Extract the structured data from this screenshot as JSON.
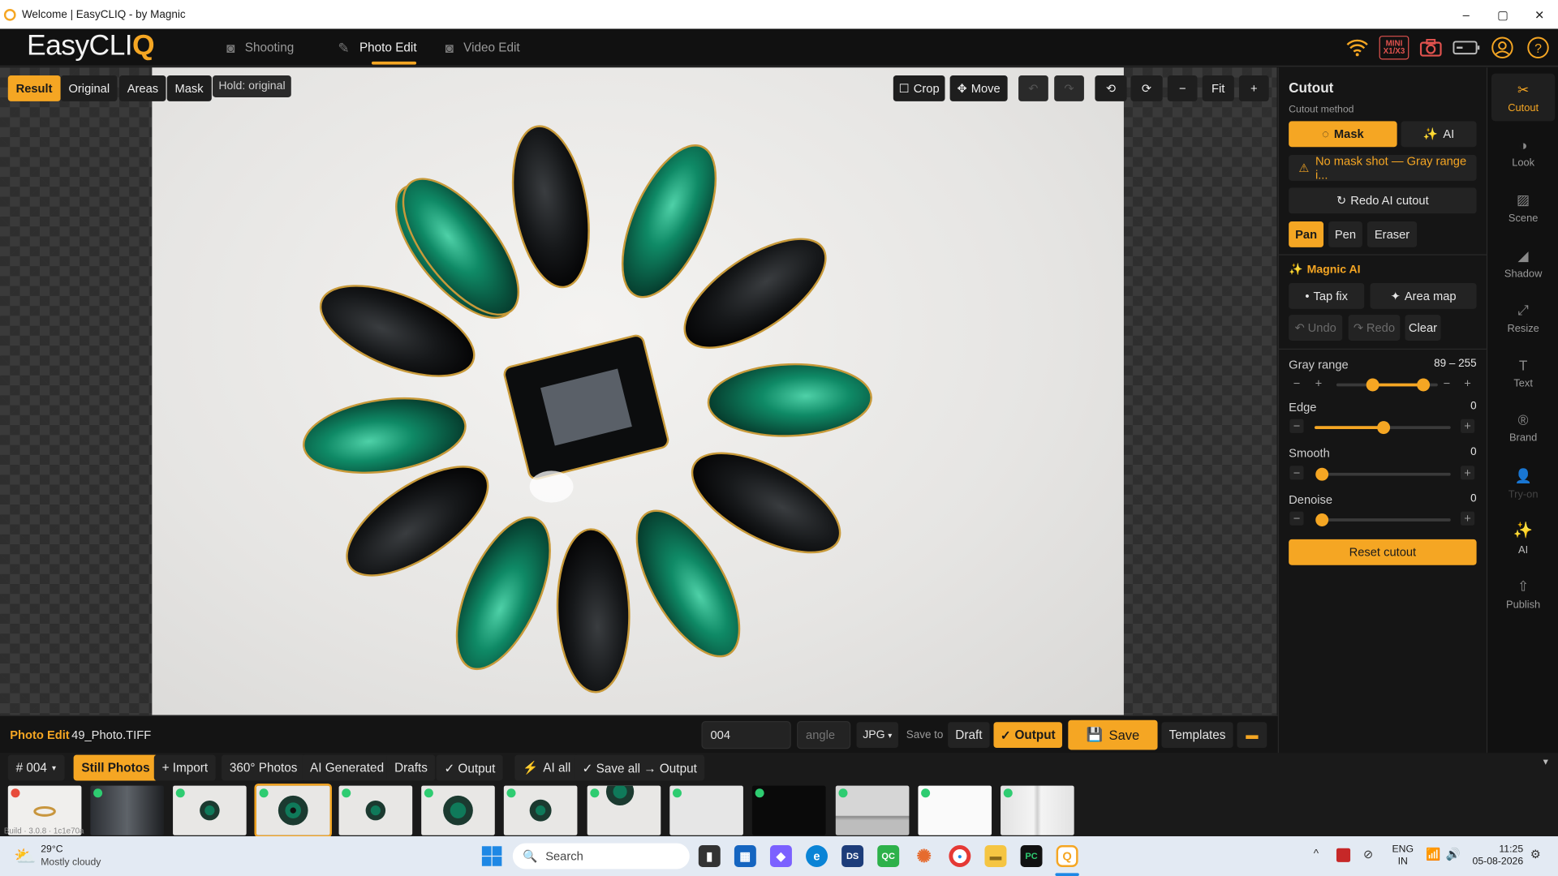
{
  "window": {
    "title": "Welcome | EasyCLIQ - by Magnic",
    "min": "–",
    "max": "▢",
    "close": "✕"
  },
  "app": {
    "logo_main": "EasyCLI",
    "logo_accent": "Q",
    "tabs": [
      {
        "label": "Shooting",
        "icon": "camera-icon"
      },
      {
        "label": "Photo Edit",
        "icon": "edit-icon"
      },
      {
        "label": "Video Edit",
        "icon": "video-icon"
      }
    ],
    "header_icons": {
      "wifi": "wifi-icon",
      "mini_line1": "MINI",
      "mini_line2": "X1/X3",
      "camera": "camera-icon",
      "battery": "battery-icon",
      "user": "user-icon",
      "help": "help-icon"
    }
  },
  "viewer": {
    "modes": [
      "Result",
      "Original",
      "Areas",
      "Mask"
    ],
    "hold_tag": "Hold: original",
    "tools": {
      "crop": "Crop",
      "move": "Move",
      "fit": "Fit",
      "zoom_out": "−",
      "zoom_in": "+",
      "rot_left": "⟲",
      "rot_right": "⟳",
      "undo": "↶",
      "redo": "↷"
    }
  },
  "panel": {
    "title": "Cutout",
    "method_label": "Cutout method",
    "method_mask": "Mask",
    "method_ai": "AI",
    "warning": "No mask shot — Gray range i...",
    "redo_ai": "Redo AI cutout",
    "tools": [
      "Pan",
      "Pen",
      "Eraser"
    ],
    "magnic_title": "Magnic AI",
    "tap_fix": "Tap fix",
    "area_map": "Area map",
    "undo": "Undo",
    "redo": "Redo",
    "clear": "Clear",
    "sliders": [
      {
        "label": "Gray range",
        "value": "89 – 255",
        "min": 89,
        "max": 255,
        "range": true
      },
      {
        "label": "Edge",
        "value": "0",
        "level": 0.5
      },
      {
        "label": "Smooth",
        "value": "0",
        "level": 0
      },
      {
        "label": "Denoise",
        "value": "0",
        "level": 0
      }
    ],
    "reset": "Reset cutout"
  },
  "sidenav": [
    {
      "label": "Cutout",
      "icon": "scissors-icon"
    },
    {
      "label": "Look",
      "icon": "contrast-icon"
    },
    {
      "label": "Scene",
      "icon": "image-icon"
    },
    {
      "label": "Shadow",
      "icon": "shadow-icon"
    },
    {
      "label": "Resize",
      "icon": "resize-icon"
    },
    {
      "label": "Text",
      "icon": "text-icon"
    },
    {
      "label": "Brand",
      "icon": "brand-icon"
    },
    {
      "label": "Try-on",
      "icon": "person-icon"
    },
    {
      "label": "AI",
      "icon": "sparkle-icon"
    },
    {
      "label": "Publish",
      "icon": "upload-icon"
    }
  ],
  "bottombar": {
    "section": "Photo Edit",
    "filename": "49_Photo.TIFF",
    "seq_value": "004",
    "angle_placeholder": "angle",
    "format": "JPG",
    "save_to": "Save to",
    "draft": "Draft",
    "output": "Output",
    "save": "Save",
    "templates": "Templates"
  },
  "strip": {
    "seq": "# 004",
    "chips": [
      "Still Photos",
      "+ Import",
      "360° Photos",
      "AI Generated",
      "Drafts",
      "✓ Output",
      "AI all",
      "✓ Save all → Output"
    ],
    "build": "Build · 3.0.8 · 1c1e70a",
    "collapse": "▾",
    "thumbs": [
      "ring",
      "room",
      "brooch",
      "brooch-selected",
      "brooch",
      "brooch",
      "brooch",
      "brooch-top",
      "blank",
      "dark",
      "grey",
      "white",
      "white"
    ]
  },
  "taskbar": {
    "temp": "29°C",
    "weather": "Mostly cloudy",
    "search": "Search",
    "lang1": "ENG",
    "lang2": "IN",
    "time": "11:25",
    "date": "05-08-2026"
  },
  "colors": {
    "accent": "#f5a623",
    "bg": "#1a1a1a",
    "status_green": "#2ecc71",
    "status_red": "#e74c3c"
  }
}
